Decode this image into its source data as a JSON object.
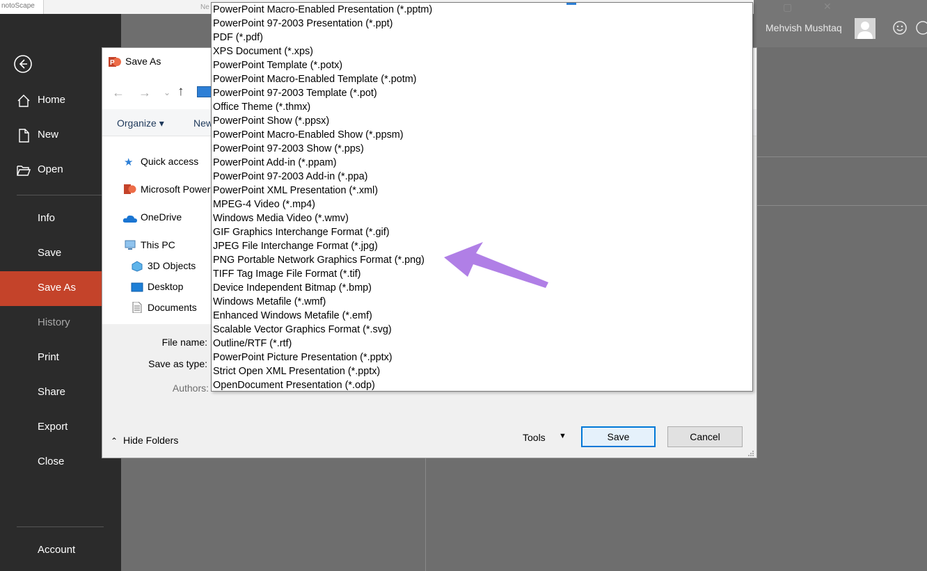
{
  "topbar": {
    "doc_fragment": "notoScape",
    "center_fragment": "Ne"
  },
  "user": {
    "name": "Mehvish Mushtaq"
  },
  "nav": {
    "items": [
      {
        "label": "Home"
      },
      {
        "label": "New"
      },
      {
        "label": "Open"
      },
      {
        "label": "Info"
      },
      {
        "label": "Save"
      },
      {
        "label": "Save As"
      },
      {
        "label": "History"
      },
      {
        "label": "Print"
      },
      {
        "label": "Share"
      },
      {
        "label": "Export"
      },
      {
        "label": "Close"
      },
      {
        "label": "Account"
      }
    ]
  },
  "dialog": {
    "title": "Save As",
    "organize": "Organize ▾",
    "new_folder": "New folder",
    "tree": [
      {
        "label": "Quick access"
      },
      {
        "label": "Microsoft PowerPoint"
      },
      {
        "label": "OneDrive"
      },
      {
        "label": "This PC"
      },
      {
        "label": "3D Objects"
      },
      {
        "label": "Desktop"
      },
      {
        "label": "Documents"
      }
    ],
    "file_name_label": "File name:",
    "save_as_type_label": "Save as type:",
    "authors_label": "Authors:",
    "hide_folders": "Hide Folders",
    "tools": "Tools",
    "save_button": "Save",
    "cancel_button": "Cancel"
  },
  "dropdown": {
    "options": [
      "PowerPoint Macro-Enabled Presentation (*.pptm)",
      "PowerPoint 97-2003 Presentation (*.ppt)",
      "PDF (*.pdf)",
      "XPS Document (*.xps)",
      "PowerPoint Template (*.potx)",
      "PowerPoint Macro-Enabled Template (*.potm)",
      "PowerPoint 97-2003 Template (*.pot)",
      "Office Theme (*.thmx)",
      "PowerPoint Show (*.ppsx)",
      "PowerPoint Macro-Enabled Show (*.ppsm)",
      "PowerPoint 97-2003 Show (*.pps)",
      "PowerPoint Add-in (*.ppam)",
      "PowerPoint 97-2003 Add-in (*.ppa)",
      "PowerPoint XML Presentation (*.xml)",
      "MPEG-4 Video (*.mp4)",
      "Windows Media Video (*.wmv)",
      "GIF Graphics Interchange Format (*.gif)",
      "JPEG File Interchange Format (*.jpg)",
      "PNG Portable Network Graphics Format (*.png)",
      "TIFF Tag Image File Format (*.tif)",
      "Device Independent Bitmap (*.bmp)",
      "Windows Metafile (*.wmf)",
      "Enhanced Windows Metafile (*.emf)",
      "Scalable Vector Graphics Format (*.svg)",
      "Outline/RTF (*.rtf)",
      "PowerPoint Picture Presentation (*.pptx)",
      "Strict Open XML Presentation (*.pptx)",
      "OpenDocument Presentation (*.odp)"
    ]
  },
  "colors": {
    "nav_bg": "#2b2b2b",
    "nav_active": "#c4432a",
    "annotation_arrow": "#b07fe6",
    "accent": "#0078d7"
  }
}
